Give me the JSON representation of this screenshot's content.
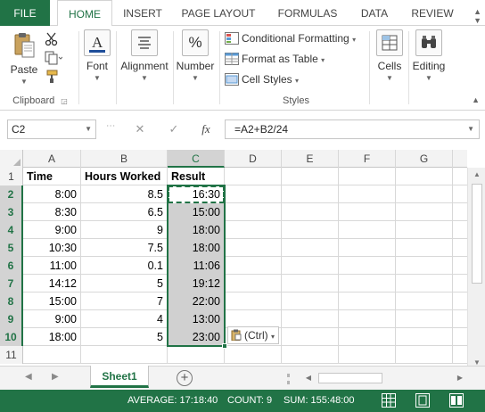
{
  "ribbon_tabs": [
    {
      "label": "FILE"
    },
    {
      "label": "HOME"
    },
    {
      "label": "INSERT"
    },
    {
      "label": "PAGE LAYOUT"
    },
    {
      "label": "FORMULAS"
    },
    {
      "label": "DATA"
    },
    {
      "label": "REVIEW"
    }
  ],
  "ribbon": {
    "clipboard": {
      "paste_label": "Paste",
      "group_label": "Clipboard"
    },
    "font_label": "Font",
    "alignment_label": "Alignment",
    "number_label": "Number",
    "styles": {
      "conditional_formatting": "Conditional Formatting",
      "format_as_table": "Format as Table",
      "cell_styles": "Cell Styles",
      "group_label": "Styles"
    },
    "cells_label": "Cells",
    "editing_label": "Editing"
  },
  "formula_bar": {
    "name_box": "C2",
    "cancel_symbol": "✕",
    "enter_symbol": "✓",
    "fx_symbol": "fx",
    "formula": "=A2+B2/24"
  },
  "sheet": {
    "column_headers": [
      "A",
      "B",
      "C",
      "D",
      "E",
      "F",
      "G"
    ],
    "row_numbers": [
      "1",
      "2",
      "3",
      "4",
      "5",
      "6",
      "7",
      "8",
      "9",
      "10",
      "11"
    ],
    "headers": {
      "a": "Time",
      "b": "Hours Worked",
      "c": "Result"
    },
    "rows": [
      {
        "a": "8:00",
        "b": "8.5",
        "c": "16:30"
      },
      {
        "a": "8:30",
        "b": "6.5",
        "c": "15:00"
      },
      {
        "a": "9:00",
        "b": "9",
        "c": "18:00"
      },
      {
        "a": "10:30",
        "b": "7.5",
        "c": "18:00"
      },
      {
        "a": "11:00",
        "b": "0.1",
        "c": "11:06"
      },
      {
        "a": "14:12",
        "b": "5",
        "c": "19:12"
      },
      {
        "a": "15:00",
        "b": "7",
        "c": "22:00"
      },
      {
        "a": "9:00",
        "b": "4",
        "c": "13:00"
      },
      {
        "a": "18:00",
        "b": "5",
        "c": "23:00"
      }
    ]
  },
  "paste_options_label": "(Ctrl)",
  "sheet_tabs": [
    {
      "label": "Sheet1"
    }
  ],
  "status_bar": {
    "average": "AVERAGE: 17:18:40",
    "count": "COUNT: 9",
    "sum": "SUM: 155:48:00"
  }
}
